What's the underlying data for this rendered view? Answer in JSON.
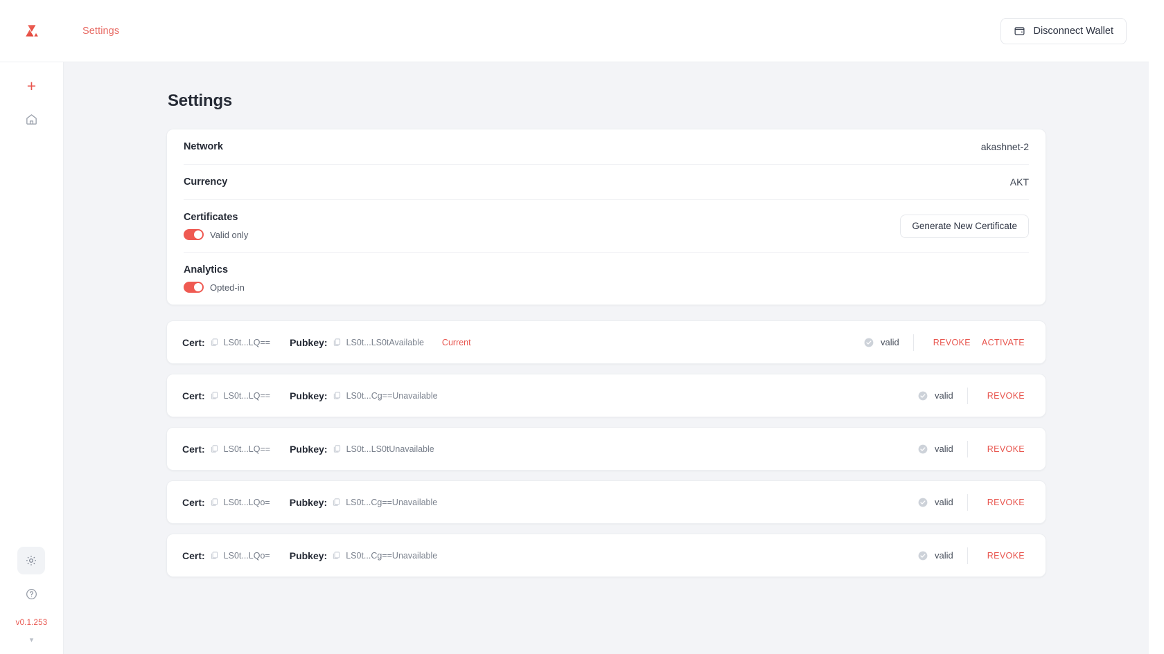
{
  "topbar": {
    "logo_name": "akash-logo",
    "breadcrumb": "Settings",
    "wallet_button_label": "Disconnect Wallet",
    "wallet_icon": "wallet-icon"
  },
  "rail": {
    "add_icon": "plus-icon",
    "home_icon": "home-icon",
    "settings_icon": "gear-icon",
    "help_icon": "question-circle-icon",
    "version": "v0.1.253",
    "caret_icon": "chevron-down-icon"
  },
  "page": {
    "title": "Settings"
  },
  "settings": {
    "network": {
      "label": "Network",
      "value": "akashnet-2"
    },
    "currency": {
      "label": "Currency",
      "value": "AKT"
    },
    "certificates": {
      "label": "Certificates",
      "toggle_label": "Valid only",
      "toggle_on": true,
      "button_label": "Generate New Certificate"
    },
    "analytics": {
      "label": "Analytics",
      "toggle_label": "Opted-in",
      "toggle_on": true
    }
  },
  "cert_labels": {
    "cert": "Cert:",
    "pubkey": "Pubkey:",
    "copy_icon": "copy-icon",
    "valid_icon": "check-circle-icon"
  },
  "certificates": [
    {
      "cert": "LS0t...LQ==",
      "pubkey": "LS0t...LS0tAvailable",
      "current": "Current",
      "status": "valid",
      "actions": [
        "REVOKE",
        "ACTIVATE"
      ]
    },
    {
      "cert": "LS0t...LQ==",
      "pubkey": "LS0t...Cg==Unavailable",
      "current": "",
      "status": "valid",
      "actions": [
        "REVOKE"
      ]
    },
    {
      "cert": "LS0t...LQ==",
      "pubkey": "LS0t...LS0tUnavailable",
      "current": "",
      "status": "valid",
      "actions": [
        "REVOKE"
      ]
    },
    {
      "cert": "LS0t...LQo=",
      "pubkey": "LS0t...Cg==Unavailable",
      "current": "",
      "status": "valid",
      "actions": [
        "REVOKE"
      ]
    },
    {
      "cert": "LS0t...LQo=",
      "pubkey": "LS0t...Cg==Unavailable",
      "current": "",
      "status": "valid",
      "actions": [
        "REVOKE"
      ]
    }
  ],
  "colors": {
    "accent": "#e8554e",
    "toggle_on": "#ef5a52",
    "page_bg": "#f3f4f7",
    "text": "#262b36"
  }
}
